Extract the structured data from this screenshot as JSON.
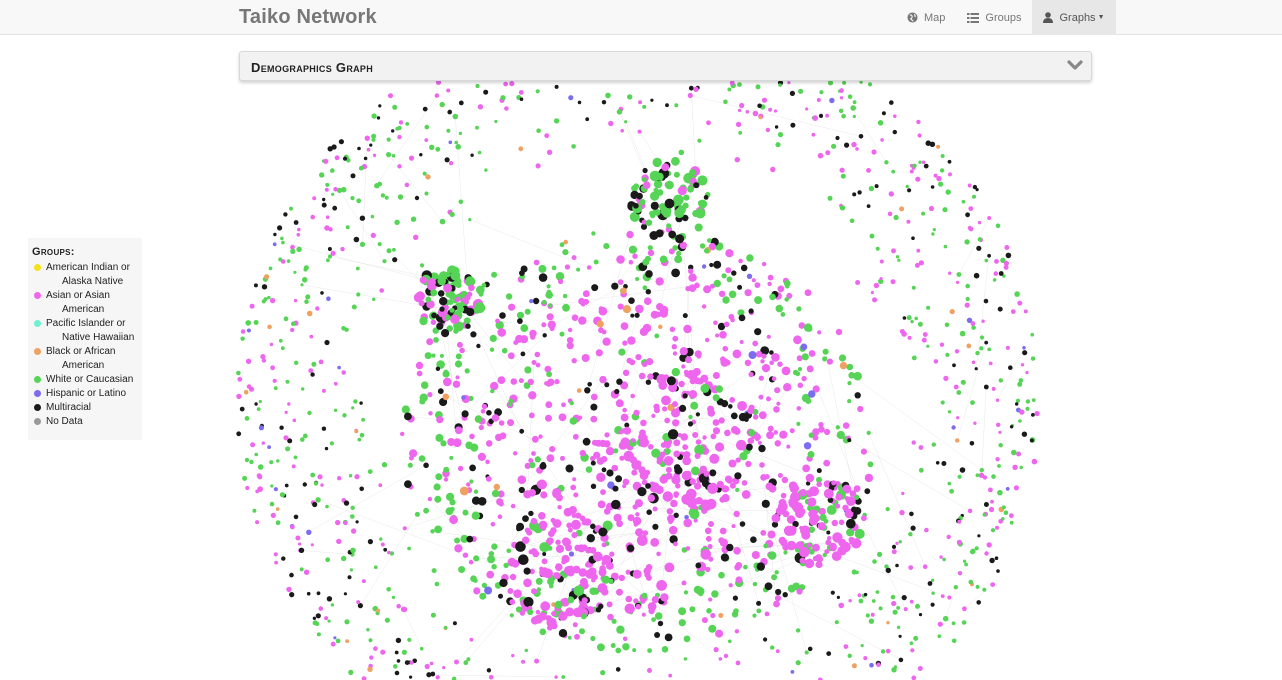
{
  "navbar": {
    "brand": "Taiko Network",
    "items": [
      {
        "label": "Map",
        "icon": "globe-icon",
        "active": false
      },
      {
        "label": "Groups",
        "icon": "list-icon",
        "active": false
      },
      {
        "label": "Graphs",
        "icon": "user-icon",
        "active": true,
        "dropdown": true
      }
    ]
  },
  "panel": {
    "title": "Demographics Graph",
    "toggle_icon": "chevron-down-icon"
  },
  "legend": {
    "title": "Groups:",
    "items": [
      {
        "line1": "American Indian or",
        "line2": "Alaska Native",
        "color": "#f5e11b"
      },
      {
        "line1": "Asian or Asian",
        "line2": "American",
        "color": "#ee66ee"
      },
      {
        "line1": "Pacific Islander or",
        "line2": "Native Hawaiian",
        "color": "#6ff0d0"
      },
      {
        "line1": "Black or African",
        "line2": "American",
        "color": "#f0a060"
      },
      {
        "line1": "White or Caucasian",
        "line2": "",
        "color": "#55d455"
      },
      {
        "line1": "Hispanic or Latino",
        "line2": "",
        "color": "#7b6cf0"
      },
      {
        "line1": "Multiracial",
        "line2": "",
        "color": "#1a1a1a"
      },
      {
        "line1": "No Data",
        "line2": "",
        "color": "#999999"
      }
    ]
  },
  "colors": {
    "asian": "#ee66ee",
    "white": "#55d455",
    "multiracial": "#1a1a1a",
    "hispanic": "#7b6cf0",
    "black": "#f0a060",
    "pacific": "#6ff0d0",
    "native": "#f5e11b",
    "edge": "#d6d6d6"
  }
}
